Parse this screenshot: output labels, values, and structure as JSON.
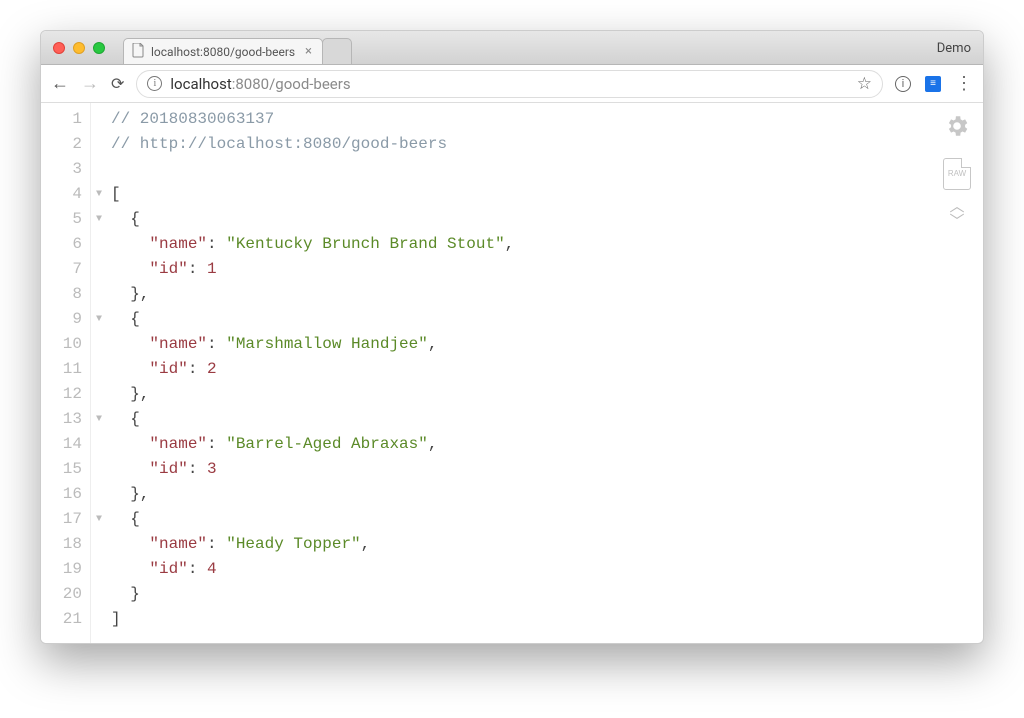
{
  "window": {
    "demo_label": "Demo"
  },
  "tab": {
    "title": "localhost:8080/good-beers"
  },
  "address": {
    "host": "localhost",
    "port": ":8080",
    "path": "/good-beers"
  },
  "code": {
    "comment_timestamp": "// 20180830063137",
    "comment_url": "// http://localhost:8080/good-beers",
    "items": [
      {
        "name": "Kentucky Brunch Brand Stout",
        "id": 1
      },
      {
        "name": "Marshmallow Handjee",
        "id": 2
      },
      {
        "name": "Barrel-Aged Abraxas",
        "id": 3
      },
      {
        "name": "Heady Topper",
        "id": 4
      }
    ]
  },
  "side": {
    "raw_label": "RAW"
  },
  "line_count": 21,
  "fold_lines": [
    4,
    5,
    9,
    13,
    17
  ]
}
